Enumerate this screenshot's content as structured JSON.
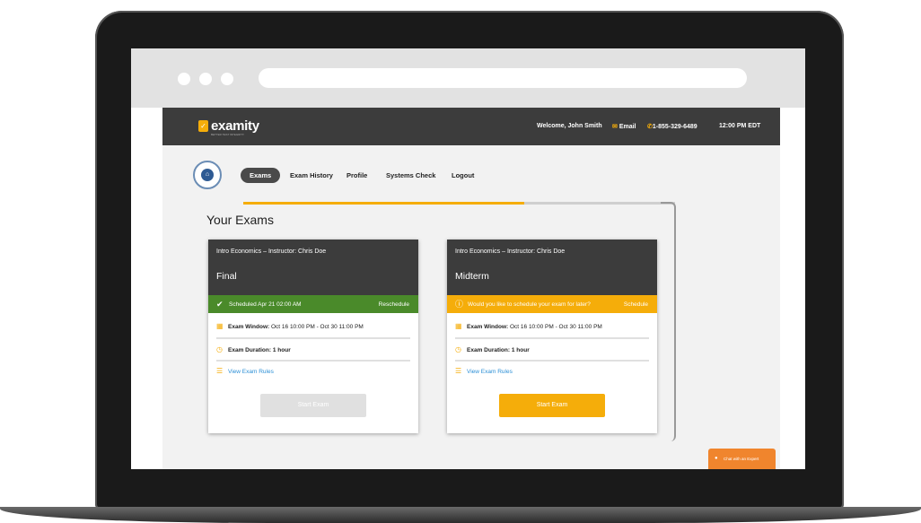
{
  "brand": {
    "name": "examity",
    "tagline": "BETTER TEST INTEGRITY"
  },
  "topbar": {
    "welcome": "Welcome, John Smith",
    "email": "Email",
    "phone": "1-855-329-6489",
    "time": "12:00 PM EDT"
  },
  "nav": {
    "items": [
      "Exams",
      "Exam History",
      "Profile",
      "Systems Check",
      "Logout"
    ],
    "active": "Exams"
  },
  "progress": 0.65,
  "page_title": "Your Exams",
  "cards": [
    {
      "course": "Intro Economics – Instructor: Chris Doe",
      "exam": "Final",
      "status_text": "Scheduled Apr 21 02:00 AM",
      "status_action": "Reschedule",
      "window_label": "Exam Window:",
      "window_value": "Oct 16 10:00 PM - Oct 30 11:00 PM",
      "duration_label": "Exam Duration:",
      "duration_value": "1 hour",
      "rules": "View Exam Rules",
      "button": "Start Exam"
    },
    {
      "course": "Intro Economics – Instructor: Chris Doe",
      "exam": "Midterm",
      "status_text": "Would you like to schedule your exam for later?",
      "status_action": "Schedule",
      "window_label": "Exam Window:",
      "window_value": "Oct 16 10:00 PM - Oct 30 11:00 PM",
      "duration_label": "Exam Duration:",
      "duration_value": "1 hour",
      "rules": "View Exam Rules",
      "button": "Start Exam"
    }
  ],
  "chat": "Chat with an Expert",
  "colors": {
    "accent": "#f5ad0a",
    "header": "#3c3c3c",
    "success": "#4a8a2a",
    "link": "#2b8fd6",
    "chat": "#f0852d"
  },
  "icons": {
    "check": "check-icon",
    "info": "info-icon",
    "calendar": "calendar-icon",
    "timer": "stopwatch-icon",
    "list": "list-icon",
    "chat": "chat-icon",
    "phone": "phone-icon",
    "email": "email-icon"
  }
}
